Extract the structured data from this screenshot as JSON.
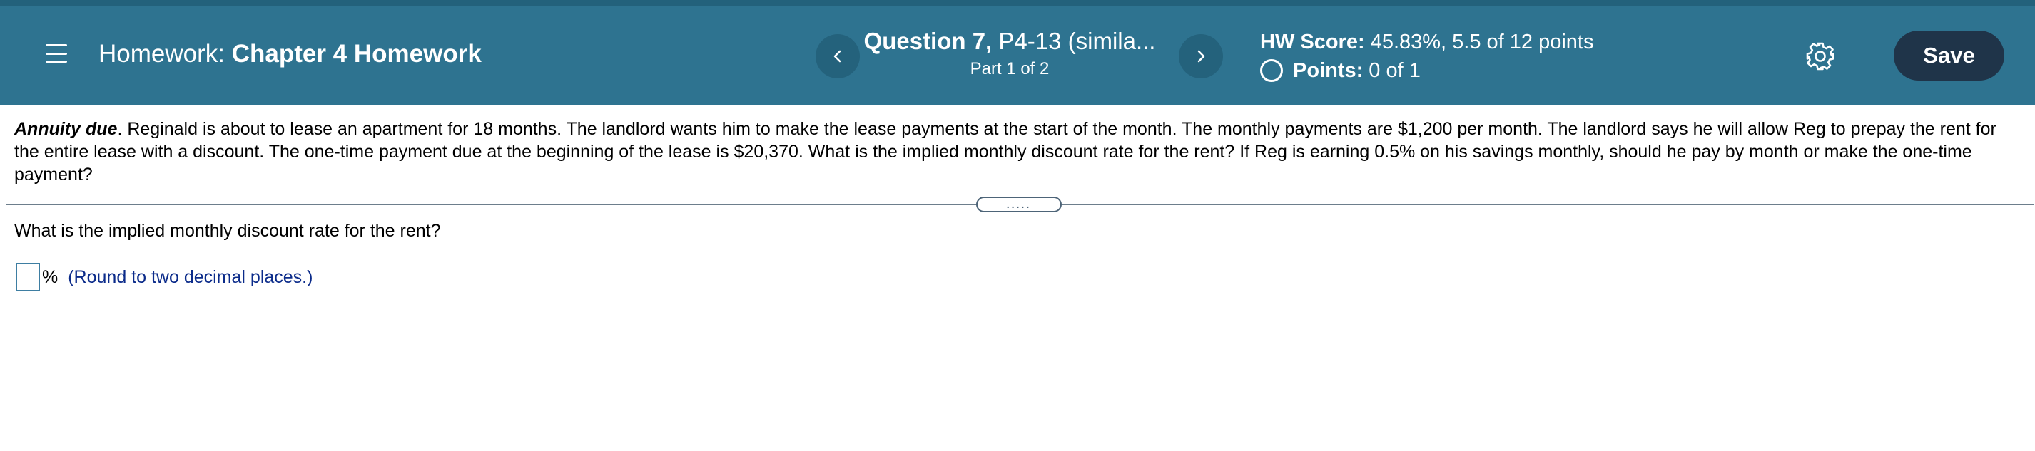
{
  "header": {
    "menu_icon": "hamburger-menu-icon",
    "title_prefix": "Homework:",
    "title_name": "Chapter 4 Homework",
    "prev_icon": "chevron-left-icon",
    "next_icon": "chevron-right-icon",
    "question_label": "Question 7,",
    "question_ref": "P4-13 (simila...",
    "part": "Part 1 of 2",
    "hw_score_label": "HW Score:",
    "hw_score_value": "45.83%, 5.5 of 12 points",
    "points_label": "Points:",
    "points_value": "0 of 1",
    "settings_icon": "gear-icon",
    "save_label": "Save",
    "colors": {
      "bar": "#2e7390",
      "nav_button": "#24627c",
      "save_button": "#1f3449"
    }
  },
  "problem": {
    "lead": "Annuity due",
    "text": ".  Reginald is about to lease an apartment for 18 months.  The landlord wants him to make the lease payments at the start of the month.  The monthly payments are $1,200 per month.  The landlord says he will allow Reg to prepay the rent for the entire lease with a discount.  The one-time payment due at the beginning of the lease is $20,370.  What is the implied monthly discount rate for the rent?  If Reg is earning 0.5% on his savings monthly, should he pay by month or make the one-time payment?"
  },
  "divider_handle": ".....",
  "question": {
    "prompt": "What is the implied monthly discount rate for the rent?",
    "answer_value": "",
    "unit": "%",
    "hint": "(Round to two decimal places.)"
  }
}
